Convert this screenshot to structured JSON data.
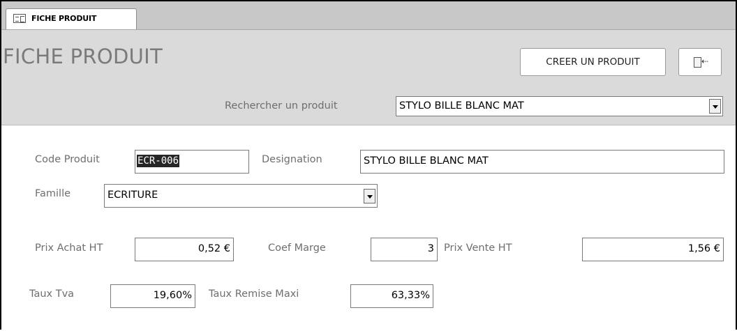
{
  "tab": {
    "label": "FICHE PRODUIT"
  },
  "header": {
    "title": "FICHE PRODUIT",
    "create_button": "CREER UN PRODUIT",
    "search_label": "Rechercher un produit",
    "search_value": "STYLO BILLE BLANC MAT"
  },
  "form": {
    "code_label": "Code Produit",
    "code_value": "ECR-006",
    "designation_label": "Designation",
    "designation_value": "STYLO BILLE BLANC MAT",
    "famille_label": "Famille",
    "famille_value": "ECRITURE",
    "prix_achat_label": "Prix Achat HT",
    "prix_achat_value": "0,52 €",
    "coef_label": "Coef Marge",
    "coef_value": "3",
    "prix_vente_label": "Prix Vente HT",
    "prix_vente_value": "1,56 €",
    "tva_label": "Taux Tva",
    "tva_value": "19,60%",
    "remise_label": "Taux Remise Maxi",
    "remise_value": "63,33%"
  },
  "icons": {
    "tab_icon": "form-icon",
    "exit_icon": "exit-door-icon",
    "dropdown_icon": "chevron-down-icon"
  }
}
